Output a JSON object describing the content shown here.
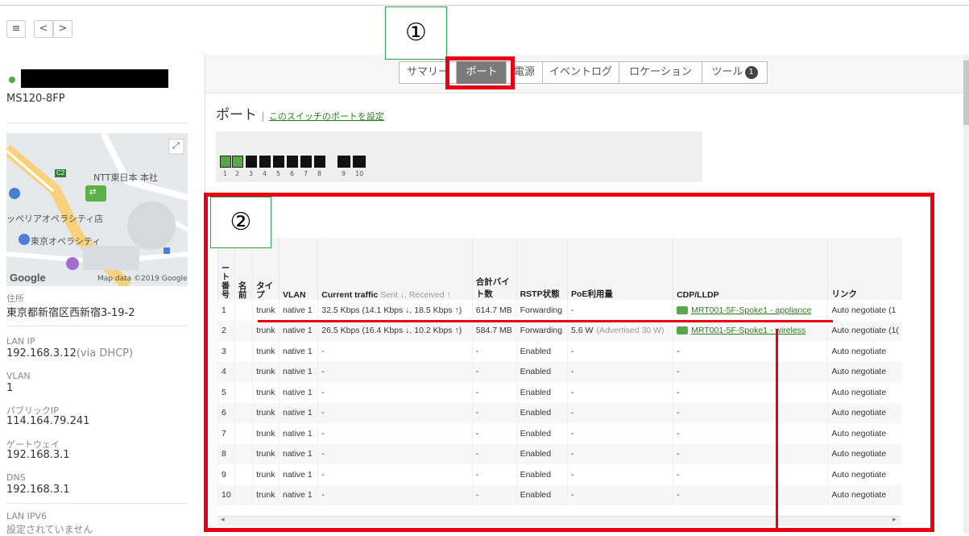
{
  "nav": {
    "menu_icon": "≡",
    "back": "<",
    "forward": ">"
  },
  "device": {
    "model": "MS120-8FP",
    "address_label": "住所",
    "address": "東京都新宿区西新宿3-19-2",
    "lanip_label": "LAN IP",
    "lanip": "192.168.3.12",
    "lanip_suffix": "(via DHCP)",
    "vlan_label": "VLAN",
    "vlan": "1",
    "publicip_label": "パブリックIP",
    "publicip": "114.164.79.241",
    "gateway_label": "ゲートウェイ",
    "gateway": "192.168.3.1",
    "dns_label": "DNS",
    "dns": "192.168.3.1",
    "lanipv6_label": "LAN IPV6",
    "lanipv6": "設定されていません"
  },
  "map": {
    "label_ntt": "NTT東日本 本社",
    "label_opera_city": "ッペリアオペラシティ店",
    "label_tokyo_opera": "東京オペラシティ",
    "label_c2": "C2",
    "google": "Google",
    "credit": "Map data ©2019 Google"
  },
  "tabs": [
    "サマリー",
    "ポート",
    "電源",
    "イベントログ",
    "ロケーション",
    "ツール"
  ],
  "tool_badge": "1",
  "annotations": {
    "one": "①",
    "two": "②"
  },
  "ports_section": {
    "title": "ポート",
    "sep": "|",
    "config_link": "このスイッチのポートを設定"
  },
  "port_numbers": [
    "1",
    "2",
    "3",
    "4",
    "5",
    "6",
    "7",
    "8",
    "9",
    "10"
  ],
  "table": {
    "headers": {
      "port": "ー ト 番 号",
      "name": "名 前",
      "type": "タイ プ",
      "vlan": "VLAN",
      "traffic": "Current traffic",
      "traffic_sub": "Sent ↓, Received ↑",
      "bytes": "合計バイト数",
      "rstp": "RSTP状態",
      "poe": "PoE利用量",
      "cdp": "CDP/LLDP",
      "link": "リンク"
    },
    "rows": [
      {
        "port": "1",
        "type": "trunk",
        "vlan": "native 1",
        "traffic": "32.5 Kbps (14.1 Kbps ↓, 18.5 Kbps ↑)",
        "bytes": "614.7 MB",
        "rstp": "Forwarding",
        "poe": "-",
        "poe_sub": "",
        "cdp": "MRT001-5F-Spoke1 - appliance",
        "link": "Auto negotiate (1"
      },
      {
        "port": "2",
        "type": "trunk",
        "vlan": "native 1",
        "traffic": "26.5 Kbps (16.4 Kbps ↓, 10.2 Kbps ↑)",
        "bytes": "584.7 MB",
        "rstp": "Forwarding",
        "poe": "5.6 W",
        "poe_sub": "(Advertised 30 W)",
        "cdp": "MRT001-5F-Spoke1 - wireless",
        "link": "Auto negotiate (1("
      },
      {
        "port": "3",
        "type": "trunk",
        "vlan": "native 1",
        "traffic": "-",
        "bytes": "-",
        "rstp": "Enabled",
        "poe": "-",
        "poe_sub": "",
        "cdp": "-",
        "link": "Auto negotiate"
      },
      {
        "port": "4",
        "type": "trunk",
        "vlan": "native 1",
        "traffic": "-",
        "bytes": "-",
        "rstp": "Enabled",
        "poe": "-",
        "poe_sub": "",
        "cdp": "-",
        "link": "Auto negotiate"
      },
      {
        "port": "5",
        "type": "trunk",
        "vlan": "native 1",
        "traffic": "-",
        "bytes": "-",
        "rstp": "Enabled",
        "poe": "-",
        "poe_sub": "",
        "cdp": "-",
        "link": "Auto negotiate"
      },
      {
        "port": "6",
        "type": "trunk",
        "vlan": "native 1",
        "traffic": "-",
        "bytes": "-",
        "rstp": "Enabled",
        "poe": "-",
        "poe_sub": "",
        "cdp": "-",
        "link": "Auto negotiate"
      },
      {
        "port": "7",
        "type": "trunk",
        "vlan": "native 1",
        "traffic": "-",
        "bytes": "-",
        "rstp": "Enabled",
        "poe": "-",
        "poe_sub": "",
        "cdp": "-",
        "link": "Auto negotiate"
      },
      {
        "port": "8",
        "type": "trunk",
        "vlan": "native 1",
        "traffic": "-",
        "bytes": "-",
        "rstp": "Enabled",
        "poe": "-",
        "poe_sub": "",
        "cdp": "-",
        "link": "Auto negotiate"
      },
      {
        "port": "9",
        "type": "trunk",
        "vlan": "native 1",
        "traffic": "-",
        "bytes": "-",
        "rstp": "Enabled",
        "poe": "-",
        "poe_sub": "",
        "cdp": "-",
        "link": "Auto negotiate"
      },
      {
        "port": "10",
        "type": "trunk",
        "vlan": "native 1",
        "traffic": "-",
        "bytes": "-",
        "rstp": "Enabled",
        "poe": "-",
        "poe_sub": "",
        "cdp": "-",
        "link": "Auto negotiate"
      }
    ]
  },
  "colors": {
    "highlight": "#e60012",
    "annotation_border": "#2e9e4e",
    "link": "#2d7d1e",
    "port_up": "#5aa64a"
  }
}
